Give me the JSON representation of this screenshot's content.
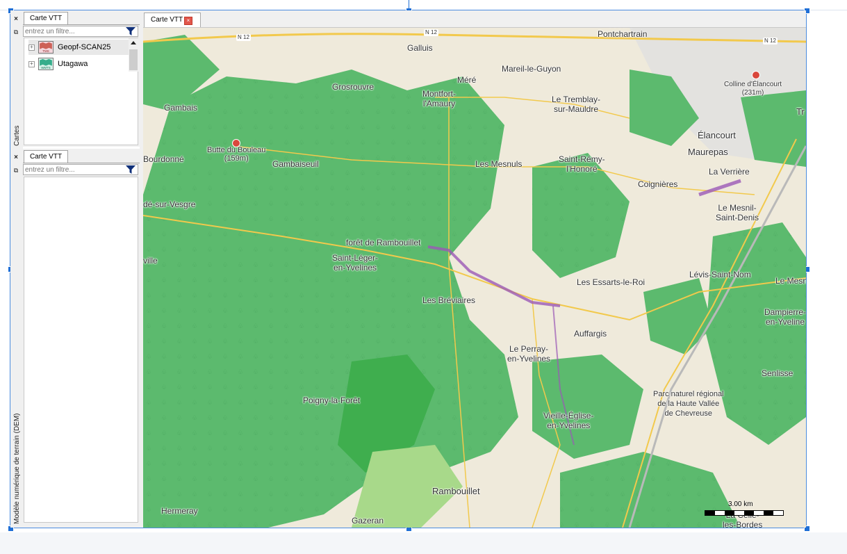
{
  "colors": {
    "accent": "#1f6fd6",
    "forest": "#5cba6e",
    "forest_dark": "#4fae64",
    "road_major": "#f2c94c",
    "purple": "#b07cc9"
  },
  "left_dock": {
    "close_glyph": "×",
    "restore_glyph": "⧉",
    "top_panel": {
      "side_label": "Cartes",
      "tab_label": "Carte VTT",
      "filter_placeholder": "entrez un filtre...",
      "items": [
        {
          "label": "Geopf-SCAN25",
          "icon": "map-tms-icon",
          "icon_caption": "TMS"
        },
        {
          "label": "Utagawa",
          "icon": "map-wmts-icon",
          "icon_caption": "WMTS"
        }
      ],
      "expander_glyph": "+"
    },
    "bottom_panel": {
      "side_label": "Modèle numérique de terrain (DEM)",
      "tab_label": "Carte VTT",
      "filter_placeholder": "entrez un filtre..."
    }
  },
  "map_view": {
    "tab_label": "Carte VTT",
    "tab_close_glyph": "×",
    "road_labels": [
      "N 12",
      "N 12",
      "N 12"
    ],
    "places": [
      {
        "name": "Galluis"
      },
      {
        "name": "Jouars-\nPontchartrain"
      },
      {
        "name": "Méré"
      },
      {
        "name": "Mareil-le-Guyon"
      },
      {
        "name": "Grosrouvre"
      },
      {
        "name": "Montfort-\nl'Amaury"
      },
      {
        "name": "Gambais"
      },
      {
        "name": "Le Tremblay-\nsur-Mauldre"
      },
      {
        "name": "Colline d'Élancourt\n(231m)"
      },
      {
        "name": "Élancourt"
      },
      {
        "name": "Maurepas"
      },
      {
        "name": "Butte du Bouleau\n(159m)"
      },
      {
        "name": "Bourdonné"
      },
      {
        "name": "Gambaiseuil"
      },
      {
        "name": "Les Mesnuls"
      },
      {
        "name": "Saint-Rémy-\nl'Honoré"
      },
      {
        "name": "La Verrière"
      },
      {
        "name": "Coignières"
      },
      {
        "name": "dé-sur-Vesgre"
      },
      {
        "name": "Le Mesnil-\nSaint-Denis"
      },
      {
        "name": "forêt de Rambouillet"
      },
      {
        "name": "Saint-Léger-\nen-Yvelines"
      },
      {
        "name": "ville"
      },
      {
        "name": "Lévis-Saint-Nom"
      },
      {
        "name": "Les Essarts-le-Roi"
      },
      {
        "name": "Le Mesn"
      },
      {
        "name": "Les Bréviaires"
      },
      {
        "name": "Dampierre-\nen-Yveline"
      },
      {
        "name": "Auffargis"
      },
      {
        "name": "Le Perray-\nen-Yvelines"
      },
      {
        "name": "Senlisse"
      },
      {
        "name": "Parc naturel régional\nde la Haute Vallée\nde Chevreuse"
      },
      {
        "name": "Poigny-la-Forêt"
      },
      {
        "name": "Vieille-Église-\nen-Yvelines"
      },
      {
        "name": "Rambouillet"
      },
      {
        "name": "Hermeray"
      },
      {
        "name": "Gazeran"
      },
      {
        "name": "La Celle-\nles-Bordes"
      },
      {
        "name": "Tr"
      }
    ],
    "scale_label": "3.00 km"
  }
}
